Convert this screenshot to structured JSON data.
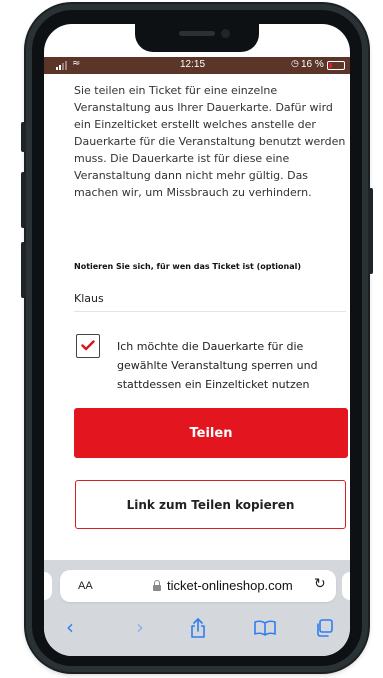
{
  "status_bar": {
    "time": "12:15",
    "battery_percent": "16 %",
    "alarm_icon": "alarm-icon",
    "battery_color": "#e01a2a",
    "bar_color": "#5b3528"
  },
  "content": {
    "info_text": "Sie teilen ein Ticket für eine einzelne Veranstaltung aus Ihrer Dauerkarte. Dafür wird ein Einzelticket erstellt welches anstelle der Dauerkarte für die Veranstaltung benutzt werden muss. Die Dauerkarte ist für diese eine Veranstaltung dann nicht mehr gültig. Das machen wir, um Missbrauch zu verhindern.",
    "recipient_label": "Notieren Sie sich, für wen das Ticket ist (optional)",
    "recipient_value": "Klaus",
    "checkbox_checked": true,
    "checkbox_label": "Ich möchte die Dauerkarte für die gewählte Veranstaltung sperren und stattdessen ein Einzelticket nutzen",
    "share_button": "Teilen",
    "copy_link_button": "Link zum Teilen kopieren",
    "accent_color": "#e3151f"
  },
  "browser": {
    "text_size_label": "AA",
    "url": "ticket-onlineshop.com",
    "icons": [
      "back-icon",
      "forward-icon",
      "share-icon",
      "bookmarks-icon",
      "tabs-icon",
      "reload-icon",
      "lock-icon"
    ],
    "icon_color": "#2f7df0"
  }
}
